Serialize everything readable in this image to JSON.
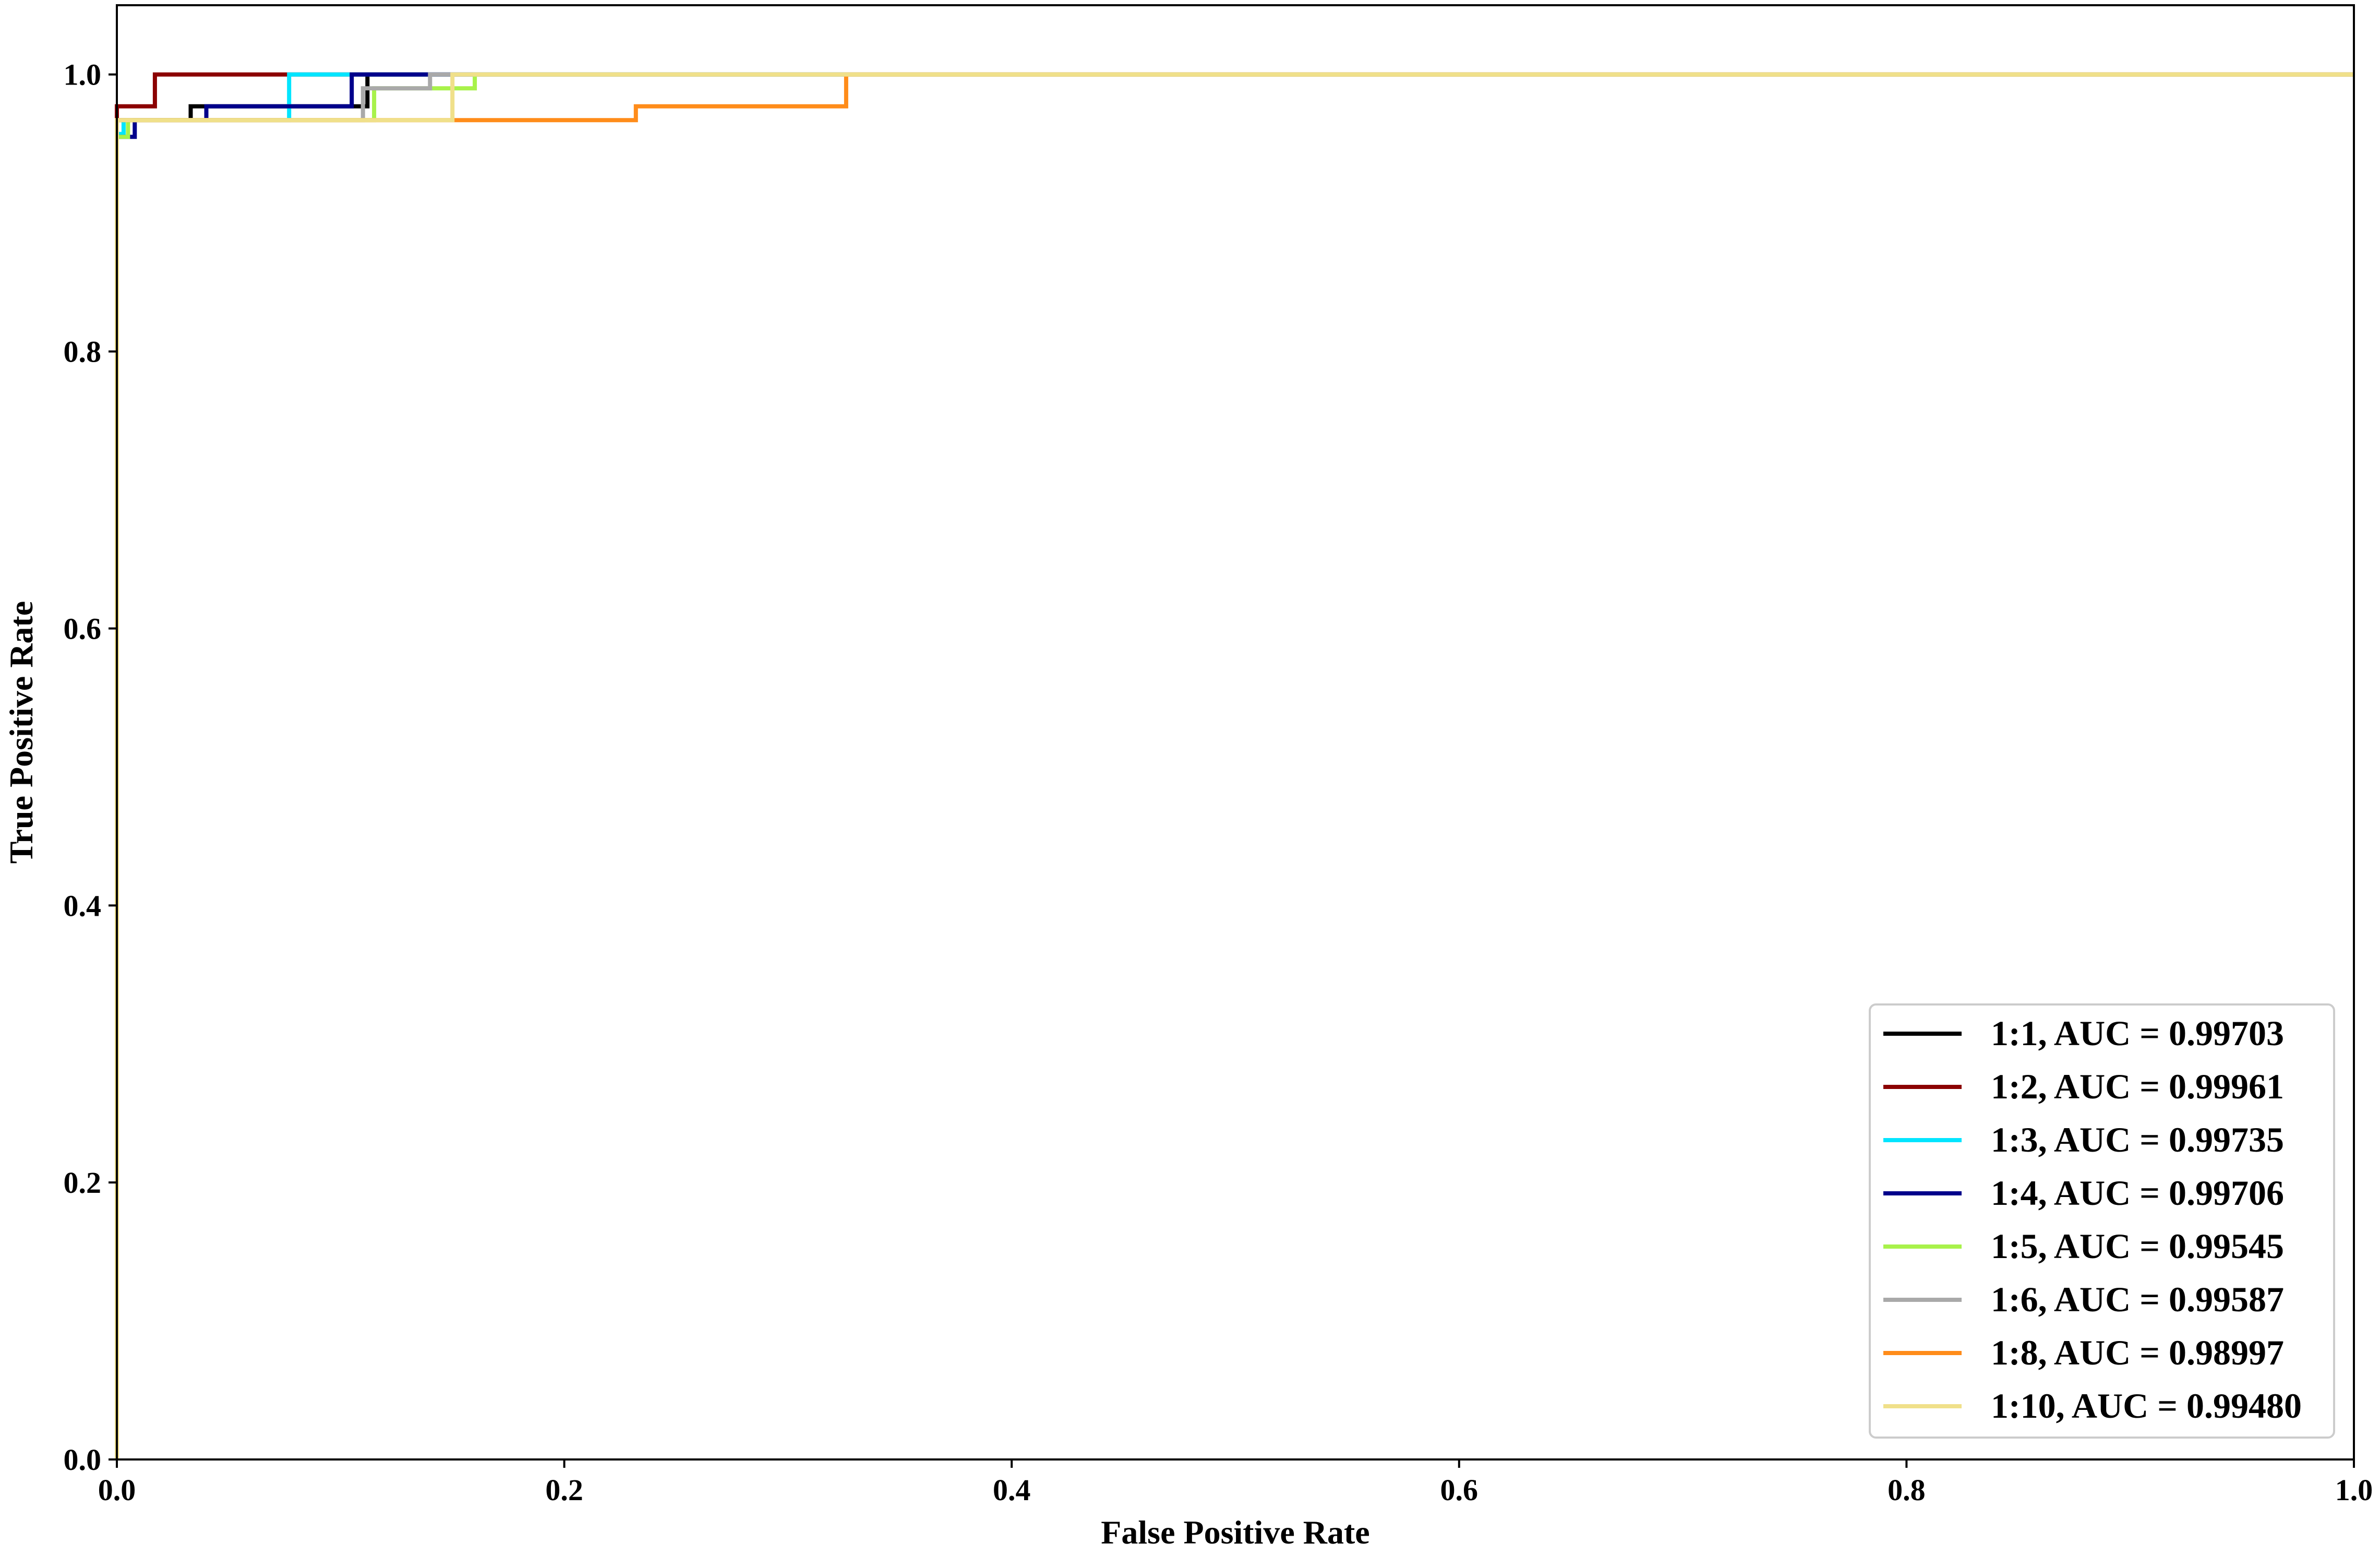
{
  "chart_data": {
    "type": "line",
    "title": "",
    "xlabel": "False Positive Rate",
    "ylabel": "True Positive Rate",
    "xlim": [
      0.0,
      1.0
    ],
    "ylim": [
      0.0,
      1.05
    ],
    "x_ticks": [
      0.0,
      0.2,
      0.4,
      0.6,
      0.8,
      1.0
    ],
    "x_tick_labels": [
      "0.0",
      "0.2",
      "0.4",
      "0.6",
      "0.8",
      "1.0"
    ],
    "y_ticks": [
      0.0,
      0.2,
      0.4,
      0.6,
      0.8,
      1.0
    ],
    "y_tick_labels": [
      "0.0",
      "0.2",
      "0.4",
      "0.6",
      "0.8",
      "1.0"
    ],
    "grid": false,
    "legend_position": "lower-right",
    "series": [
      {
        "name": "1:1, AUC = 0.99703",
        "color": "#000000",
        "x": [
          0,
          0,
          0.033,
          0.033,
          0.112,
          0.112,
          1.0
        ],
        "y": [
          0,
          0.967,
          0.967,
          0.977,
          0.977,
          1.0,
          1.0
        ]
      },
      {
        "name": "1:2, AUC = 0.99961",
        "color": "#8b0000",
        "x": [
          0,
          0,
          0.017,
          0.017,
          1.0
        ],
        "y": [
          0,
          0.977,
          0.977,
          1.0,
          1.0
        ]
      },
      {
        "name": "1:3, AUC = 0.99735",
        "color": "#00e5ff",
        "x": [
          0,
          0,
          0.003,
          0.003,
          0.077,
          0.077,
          1.0
        ],
        "y": [
          0,
          0.957,
          0.957,
          0.967,
          0.967,
          1.0,
          1.0
        ]
      },
      {
        "name": "1:4, AUC = 0.99706",
        "color": "#00008b",
        "x": [
          0,
          0,
          0.008,
          0.008,
          0.04,
          0.04,
          0.105,
          0.105,
          0.14,
          0.14,
          1.0
        ],
        "y": [
          0.2,
          0.955,
          0.955,
          0.967,
          0.967,
          0.977,
          0.977,
          1.0,
          1.0,
          1.0,
          1.0
        ]
      },
      {
        "name": "1:5, AUC = 0.99545",
        "color": "#a8f24a",
        "x": [
          0,
          0,
          0.005,
          0.005,
          0.115,
          0.115,
          0.16,
          0.16,
          1.0
        ],
        "y": [
          0,
          0.955,
          0.955,
          0.967,
          0.967,
          0.99,
          0.99,
          1.0,
          1.0
        ]
      },
      {
        "name": "1:6, AUC = 0.99587",
        "color": "#a9a9a9",
        "x": [
          0,
          0,
          0.11,
          0.11,
          0.14,
          0.14,
          1.0
        ],
        "y": [
          0,
          0.967,
          0.967,
          0.99,
          0.99,
          1.0,
          1.0
        ]
      },
      {
        "name": "1:8, AUC = 0.98997",
        "color": "#ff8c1a",
        "x": [
          0,
          0,
          0.15,
          0.15,
          0.232,
          0.232,
          0.326,
          0.326,
          1.0
        ],
        "y": [
          0,
          0.967,
          0.967,
          0.967,
          0.967,
          0.977,
          0.977,
          1.0,
          1.0
        ]
      },
      {
        "name": "1:10, AUC = 0.99480",
        "color": "#f0e08a",
        "x": [
          0,
          0,
          0.15,
          0.15,
          1.0
        ],
        "y": [
          0,
          0.967,
          0.967,
          1.0,
          1.0
        ]
      }
    ]
  }
}
